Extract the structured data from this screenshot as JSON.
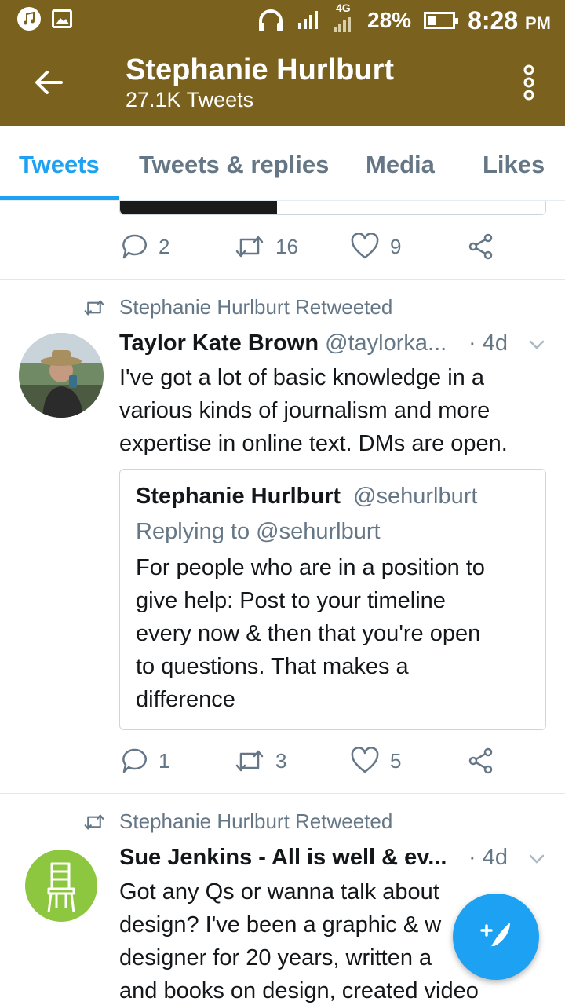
{
  "status_bar": {
    "battery": "28%",
    "network": "4G",
    "battery_level": 0.28,
    "time": "8:28",
    "ampm": "PM"
  },
  "header": {
    "title": "Stephanie Hurlburt",
    "subtitle": "27.1K Tweets"
  },
  "tabs": [
    {
      "label": "Tweets",
      "active": true
    },
    {
      "label": "Tweets & replies",
      "active": false
    },
    {
      "label": "Media",
      "active": false
    },
    {
      "label": "Likes",
      "active": false
    }
  ],
  "top_tweet_actions": {
    "replies": "2",
    "retweets": "16",
    "likes": "9"
  },
  "tweets": [
    {
      "retweeted_by": "Stephanie Hurlburt Retweeted",
      "name": "Taylor Kate Brown",
      "handle": "@taylorka...",
      "time": "· 4d",
      "text_lines": [
        "I've got a lot of basic knowledge in a",
        "various kinds of journalism and more",
        "expertise in online text. DMs are open."
      ],
      "quote": {
        "name": "Stephanie Hurlburt",
        "handle": "@sehurlburt",
        "replying": "Replying to @sehurlburt",
        "text_lines": [
          "For people who are in a position to",
          "give help: Post to your timeline",
          "every now & then that you're open",
          "to questions. That makes a",
          "difference"
        ]
      },
      "actions": {
        "replies": "1",
        "retweets": "3",
        "likes": "5"
      }
    },
    {
      "retweeted_by": "Stephanie Hurlburt Retweeted",
      "name": "Sue Jenkins - All is well & ev...",
      "time": "· 4d",
      "text_lines": [
        "Got any Qs or wanna talk about",
        "design? I've been a graphic & w",
        "designer for 20 years, written a",
        "and books on design, created video"
      ]
    }
  ],
  "colors": {
    "header_bg": "#7a621e",
    "accent": "#1da1f2",
    "muted": "#657786",
    "avatar_green": "#8dc63f"
  },
  "icons": [
    "music-icon",
    "image-icon",
    "headphones-icon",
    "signal-icon",
    "battery-icon",
    "back-arrow-icon",
    "more-vertical-icon",
    "reply-icon",
    "retweet-icon",
    "like-icon",
    "share-icon",
    "chevron-down-icon",
    "compose-icon"
  ]
}
